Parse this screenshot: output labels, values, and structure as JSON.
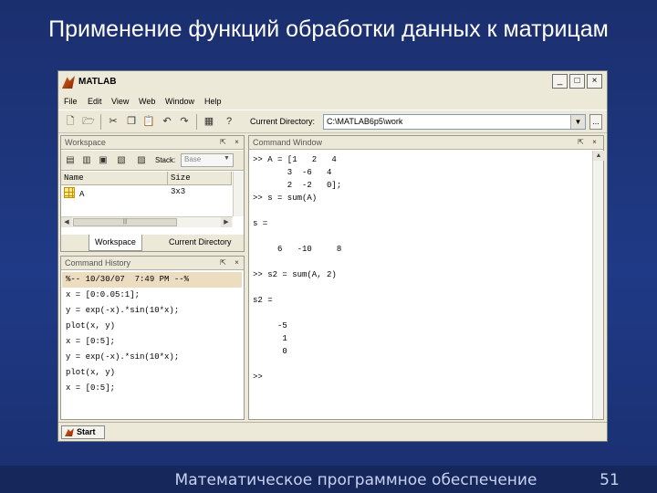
{
  "slide": {
    "title": "Применение функций обработки данных к матрицам",
    "footer": "Математическое программное обеспечение",
    "page_number": "51"
  },
  "window": {
    "title": "MATLAB",
    "controls": {
      "minimize": "_",
      "maximize": "□",
      "close": "×"
    }
  },
  "menu": [
    "File",
    "Edit",
    "View",
    "Web",
    "Window",
    "Help"
  ],
  "toolbar": {
    "current_directory_label": "Current Directory:",
    "current_directory_value": "C:\\MATLAB6p5\\work",
    "browse_label": "..."
  },
  "workspace": {
    "title": "Workspace",
    "stack_label": "Stack:",
    "stack_value": "Base",
    "columns": [
      "Name",
      "Size"
    ],
    "rows": [
      {
        "name": "A",
        "size": "3x3"
      }
    ],
    "tabs": [
      "Workspace",
      "Current Directory"
    ]
  },
  "history": {
    "title": "Command History",
    "lines": [
      "%-- 10/30/07  7:49 PM --%",
      "x = [0:0.05:1];",
      "y = exp(-x).*sin(10*x);",
      "plot(x, y)",
      "x = [0:5];",
      "y = exp(-x).*sin(10*x);",
      "plot(x, y)",
      "x = [0:5];"
    ]
  },
  "command_window": {
    "title": "Command Window",
    "lines": [
      ">> A = [1   2   4",
      "       3  -6   4",
      "       2  -2   0];",
      ">> s = sum(A)",
      "",
      "s =",
      "",
      "     6   -10     8",
      "",
      ">> s2 = sum(A, 2)",
      "",
      "s2 =",
      "",
      "     -5",
      "      1",
      "      0",
      "",
      ">>"
    ]
  },
  "statusbar": {
    "start_label": "Start"
  }
}
